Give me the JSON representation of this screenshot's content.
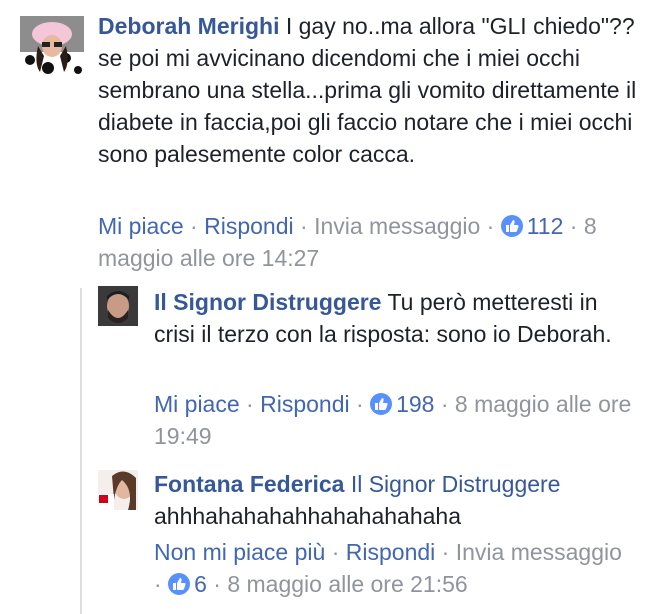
{
  "comments": [
    {
      "author": "Deborah Merighi",
      "text": "I gay no..ma allora \"GLI chiedo\"??se poi mi avvicinano dicendomi che i miei occhi sembrano una stella...prima gli vomito direttamente il diabete in faccia,poi gli faccio notare che i miei occhi sono palesemente color cacca.",
      "actions": {
        "like": "Mi piace",
        "reply": "Rispondi",
        "message": "Invia messaggio",
        "reactions": "112",
        "timestamp": "8 maggio alle ore 14:27"
      }
    }
  ],
  "replies": [
    {
      "author": "Il Signor Distruggere",
      "text": "Tu però metteresti in crisi il terzo con la risposta: sono io Deborah.",
      "actions": {
        "like": "Mi piace",
        "reply": "Rispondi",
        "reactions": "198",
        "timestamp": "8 maggio alle ore 19:49"
      }
    },
    {
      "author": "Fontana Federica",
      "tag": "Il Signor Distruggere",
      "text": "ahhhahahahahhahahahahaha",
      "actions": {
        "like": "Non mi piace più",
        "reply": "Rispondi",
        "message": "Invia messaggio",
        "reactions": "6",
        "timestamp": "8 maggio alle ore 21:56"
      }
    }
  ],
  "colors": {
    "author": "#365899",
    "link": "#4267b2",
    "meta": "#90949c",
    "like_badge": "#5890ff"
  }
}
